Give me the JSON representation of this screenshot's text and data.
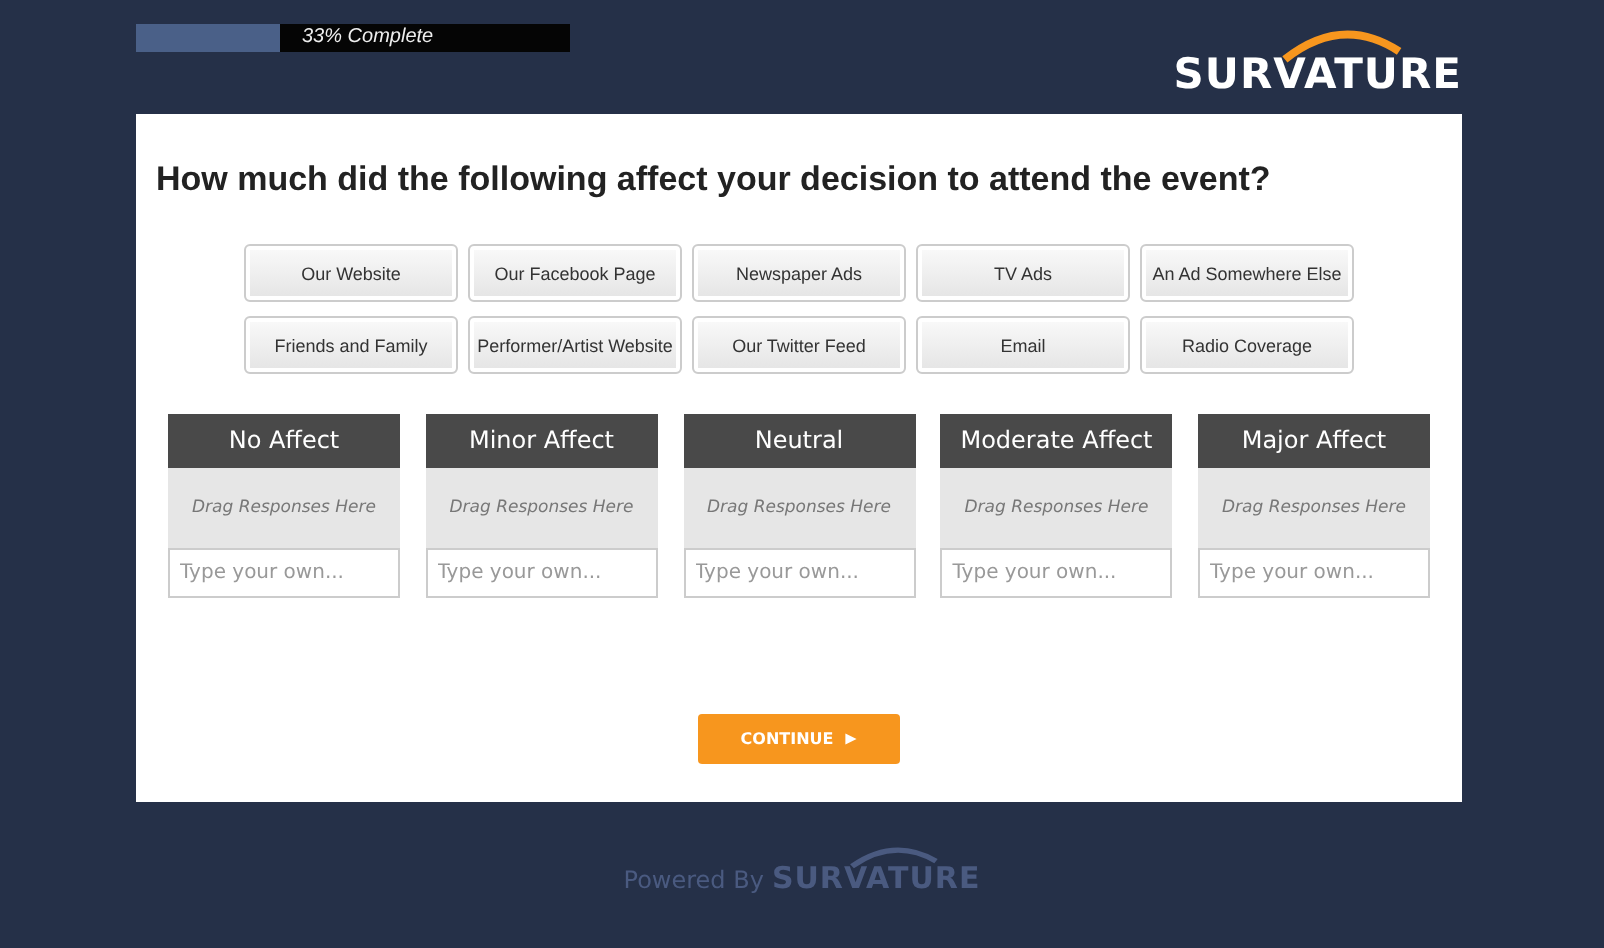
{
  "progress": {
    "level": 0.33,
    "label": "33% Complete"
  },
  "logo": {
    "text": "SURVATURE"
  },
  "question": "How much did the following affect your decision to attend the event?",
  "responses": [
    "Our Website",
    "Our Facebook Page",
    "Newspaper Ads",
    "TV Ads",
    "An Ad Somewhere Else",
    "Friends and Family",
    "Performer/Artist Website",
    "Our Twitter Feed",
    "Email",
    "Radio Coverage"
  ],
  "categories": [
    {
      "title": "No Affect",
      "drop_hint": "Drag Responses Here",
      "placeholder": "Type your own..."
    },
    {
      "title": "Minor Affect",
      "drop_hint": "Drag Responses Here",
      "placeholder": "Type your own..."
    },
    {
      "title": "Neutral",
      "drop_hint": "Drag Responses Here",
      "placeholder": "Type your own..."
    },
    {
      "title": "Moderate Affect",
      "drop_hint": "Drag Responses Here",
      "placeholder": "Type your own..."
    },
    {
      "title": "Major Affect",
      "drop_hint": "Drag Responses Here",
      "placeholder": "Type your own..."
    }
  ],
  "continue_button": "CONTINUE",
  "footer": {
    "prefix": "Powered By",
    "logo": "SURVATURE"
  }
}
